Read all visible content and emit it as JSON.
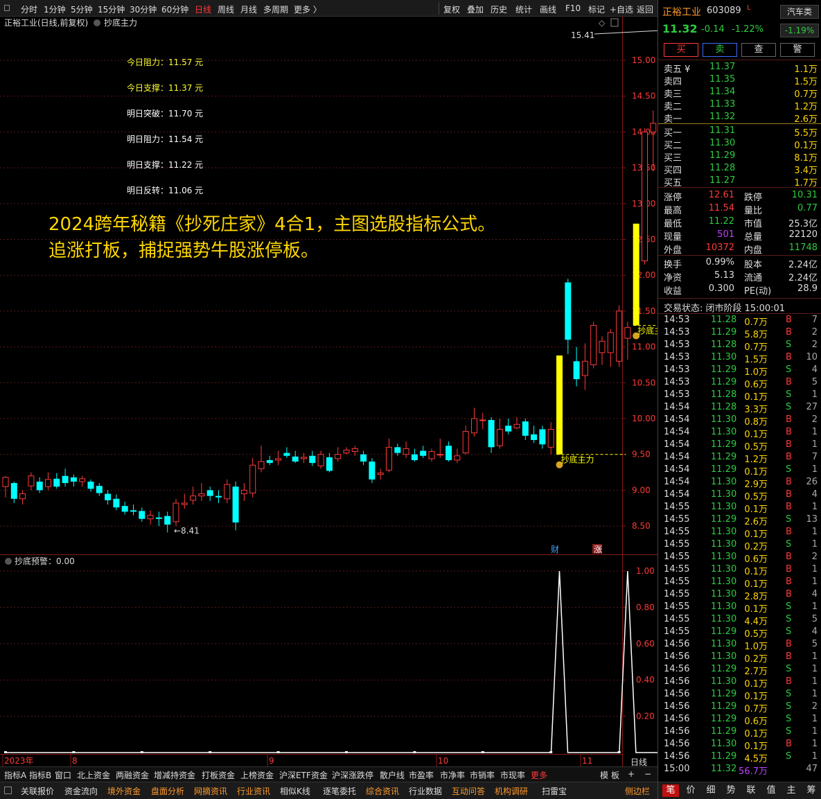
{
  "toolbar": {
    "timeframes": [
      "分时",
      "1分钟",
      "5分钟",
      "15分钟",
      "30分钟",
      "60分钟",
      "日线",
      "周线",
      "月线",
      "多周期",
      "更多 〉"
    ],
    "active_index": 6,
    "right_buttons": [
      "复权",
      "叠加",
      "历史",
      "统计",
      "画线",
      "F10",
      "标记",
      "+自选",
      "返回"
    ]
  },
  "chart": {
    "header_title": "正裕工业(日线,前复权)",
    "indicator_name": "抄底主力",
    "levels": [
      {
        "label": "今日阻力：11.57 元",
        "color": "#ffff33"
      },
      {
        "label": "今日支撑：11.37 元",
        "color": "#ffff33"
      },
      {
        "label": "明日突破：11.70 元",
        "color": "#ffffff"
      },
      {
        "label": "明日阻力：11.54 元",
        "color": "#ffffff"
      },
      {
        "label": "明日支撑：11.22 元",
        "color": "#ffffff"
      },
      {
        "label": "明日反转：11.06 元",
        "color": "#ffffff"
      }
    ],
    "promo_line1": "2024跨年秘籍《抄死庄家》4合1，主图选股指标公式。",
    "promo_line2": "追涨打板，捕捉强势牛股涨停板。",
    "high_label": "15.41",
    "low_label": "←8.41",
    "signal_label": "抄底主力",
    "marker_cai": "财",
    "marker_zhang": "涨",
    "price_axis": [
      "15.00",
      "14.50",
      "14.00",
      "13.50",
      "13.00",
      "12.50",
      "12.00",
      "11.50",
      "11.00",
      "10.50",
      "10.00",
      "9.50",
      "9.00",
      "8.50"
    ],
    "date_labels": [
      "2023年",
      "8",
      "9",
      "10",
      "11"
    ],
    "sub_indicator": "抄底预警：0.00",
    "sub_axis": [
      "1.00",
      "0.80",
      "0.60",
      "0.40",
      "0.20"
    ],
    "period_label": "日线"
  },
  "chart_data": {
    "type": "candlestick",
    "price_range": [
      8.41,
      15.41
    ],
    "candles": [
      {
        "o": 9.05,
        "c": 9.18,
        "h": 9.2,
        "l": 8.9
      },
      {
        "o": 9.1,
        "c": 8.88,
        "h": 9.12,
        "l": 8.82
      },
      {
        "o": 8.88,
        "c": 8.95,
        "h": 9.0,
        "l": 8.8
      },
      {
        "o": 9.06,
        "c": 9.2,
        "h": 9.25,
        "l": 9.0
      },
      {
        "o": 9.12,
        "c": 9.0,
        "h": 9.18,
        "l": 8.96
      },
      {
        "o": 9.05,
        "c": 9.15,
        "h": 9.25,
        "l": 9.0
      },
      {
        "o": 9.16,
        "c": 9.05,
        "h": 9.24,
        "l": 9.02
      },
      {
        "o": 9.2,
        "c": 9.1,
        "h": 9.3,
        "l": 9.05
      },
      {
        "o": 9.18,
        "c": 9.12,
        "h": 9.22,
        "l": 9.05
      },
      {
        "o": 9.12,
        "c": 9.16,
        "h": 9.2,
        "l": 9.05
      },
      {
        "o": 9.12,
        "c": 9.02,
        "h": 9.15,
        "l": 8.98
      },
      {
        "o": 9.06,
        "c": 8.96,
        "h": 9.1,
        "l": 8.92
      },
      {
        "o": 8.95,
        "c": 8.86,
        "h": 9.0,
        "l": 8.8
      },
      {
        "o": 8.88,
        "c": 8.76,
        "h": 8.94,
        "l": 8.72
      },
      {
        "o": 8.78,
        "c": 8.7,
        "h": 8.84,
        "l": 8.66
      },
      {
        "o": 8.72,
        "c": 8.7,
        "h": 8.8,
        "l": 8.65
      },
      {
        "o": 8.71,
        "c": 8.6,
        "h": 8.76,
        "l": 8.56
      },
      {
        "o": 8.6,
        "c": 8.65,
        "h": 8.72,
        "l": 8.52
      },
      {
        "o": 8.62,
        "c": 8.6,
        "h": 8.7,
        "l": 8.5
      },
      {
        "o": 8.64,
        "c": 8.52,
        "h": 8.7,
        "l": 8.41
      },
      {
        "o": 8.56,
        "c": 8.82,
        "h": 8.88,
        "l": 8.5
      },
      {
        "o": 8.8,
        "c": 8.82,
        "h": 8.95,
        "l": 8.74
      },
      {
        "o": 8.86,
        "c": 8.92,
        "h": 9.05,
        "l": 8.8
      },
      {
        "o": 8.92,
        "c": 8.95,
        "h": 9.1,
        "l": 8.85
      },
      {
        "o": 9.0,
        "c": 8.92,
        "h": 9.05,
        "l": 8.85
      },
      {
        "o": 8.92,
        "c": 8.9,
        "h": 9.0,
        "l": 8.82
      },
      {
        "o": 8.88,
        "c": 9.08,
        "h": 9.15,
        "l": 8.82
      },
      {
        "o": 9.05,
        "c": 8.55,
        "h": 9.12,
        "l": 8.44
      },
      {
        "o": 8.95,
        "c": 9.0,
        "h": 9.1,
        "l": 8.85
      },
      {
        "o": 8.96,
        "c": 9.35,
        "h": 9.45,
        "l": 8.9
      },
      {
        "o": 9.3,
        "c": 9.4,
        "h": 9.62,
        "l": 9.25
      },
      {
        "o": 9.42,
        "c": 9.38,
        "h": 9.48,
        "l": 9.35
      },
      {
        "o": 9.42,
        "c": 9.44,
        "h": 9.55,
        "l": 9.35
      },
      {
        "o": 9.52,
        "c": 9.48,
        "h": 9.6,
        "l": 9.45
      },
      {
        "o": 9.47,
        "c": 9.4,
        "h": 9.55,
        "l": 9.38
      },
      {
        "o": 9.44,
        "c": 9.46,
        "h": 9.52,
        "l": 9.38
      },
      {
        "o": 9.48,
        "c": 9.38,
        "h": 9.55,
        "l": 9.34
      },
      {
        "o": 9.34,
        "c": 9.5,
        "h": 9.55,
        "l": 9.3
      },
      {
        "o": 9.46,
        "c": 9.27,
        "h": 9.52,
        "l": 9.25
      },
      {
        "o": 9.44,
        "c": 9.5,
        "h": 9.6,
        "l": 9.4
      },
      {
        "o": 9.52,
        "c": 9.56,
        "h": 9.6,
        "l": 9.5
      },
      {
        "o": 9.54,
        "c": 9.58,
        "h": 9.62,
        "l": 9.48
      },
      {
        "o": 9.5,
        "c": 9.4,
        "h": 9.55,
        "l": 9.35
      },
      {
        "o": 9.4,
        "c": 9.15,
        "h": 9.45,
        "l": 9.1
      },
      {
        "o": 9.22,
        "c": 9.24,
        "h": 9.3,
        "l": 9.15
      },
      {
        "o": 9.28,
        "c": 9.6,
        "h": 9.72,
        "l": 9.25
      },
      {
        "o": 9.6,
        "c": 9.52,
        "h": 9.65,
        "l": 9.48
      },
      {
        "o": 9.5,
        "c": 9.58,
        "h": 9.68,
        "l": 9.45
      },
      {
        "o": 9.5,
        "c": 9.42,
        "h": 9.58,
        "l": 9.4
      },
      {
        "o": 9.55,
        "c": 9.48,
        "h": 9.62,
        "l": 9.45
      },
      {
        "o": 9.44,
        "c": 9.54,
        "h": 9.58,
        "l": 9.4
      },
      {
        "o": 9.5,
        "c": 9.5,
        "h": 9.72,
        "l": 9.45
      },
      {
        "o": 9.62,
        "c": 9.42,
        "h": 9.68,
        "l": 9.4
      },
      {
        "o": 9.42,
        "c": 9.48,
        "h": 9.58,
        "l": 9.38
      },
      {
        "o": 9.52,
        "c": 9.82,
        "h": 9.9,
        "l": 9.5
      },
      {
        "o": 9.8,
        "c": 10.0,
        "h": 10.15,
        "l": 9.75
      },
      {
        "o": 9.98,
        "c": 9.98,
        "h": 10.08,
        "l": 9.85
      },
      {
        "o": 9.98,
        "c": 9.6,
        "h": 10.02,
        "l": 9.52
      },
      {
        "o": 9.62,
        "c": 9.85,
        "h": 10.0,
        "l": 9.58
      },
      {
        "o": 9.9,
        "c": 9.82,
        "h": 10.0,
        "l": 9.78
      },
      {
        "o": 9.87,
        "c": 9.92,
        "h": 10.02,
        "l": 9.85
      },
      {
        "o": 9.96,
        "c": 9.76,
        "h": 10.0,
        "l": 9.7
      },
      {
        "o": 9.78,
        "c": 9.7,
        "h": 9.9,
        "l": 9.66
      },
      {
        "o": 9.85,
        "c": 9.64,
        "h": 9.9,
        "l": 9.58
      },
      {
        "o": 9.6,
        "c": 9.85,
        "h": 9.95,
        "l": 9.5
      },
      {
        "o": 9.5,
        "c": 10.88,
        "h": 10.88,
        "l": 9.5,
        "yellow": true
      },
      {
        "o": 11.9,
        "c": 11.1,
        "h": 11.95,
        "l": 10.9
      },
      {
        "o": 10.8,
        "c": 10.55,
        "h": 11.0,
        "l": 10.45
      },
      {
        "o": 10.6,
        "c": 10.8,
        "h": 11.05,
        "l": 10.4
      },
      {
        "o": 10.75,
        "c": 11.3,
        "h": 11.35,
        "l": 10.7
      },
      {
        "o": 10.92,
        "c": 11.08,
        "h": 11.15,
        "l": 10.75
      },
      {
        "o": 10.92,
        "c": 11.2,
        "h": 11.25,
        "l": 10.72
      },
      {
        "o": 10.8,
        "c": 11.5,
        "h": 11.58,
        "l": 10.72
      },
      {
        "o": 11.12,
        "c": 11.27,
        "h": 11.35,
        "l": 10.82
      },
      {
        "o": 11.3,
        "c": 12.72,
        "h": 12.72,
        "l": 11.3,
        "yellow": true
      },
      {
        "o": 12.2,
        "c": 14.0,
        "h": 14.05,
        "l": 12.15
      },
      {
        "o": 14.0,
        "c": 14.12,
        "h": 14.3,
        "l": 13.45
      },
      {
        "o": 14.75,
        "c": 13.85,
        "h": 15.41,
        "l": 13.3
      }
    ],
    "alert_peaks": [
      65,
      73
    ]
  },
  "quote": {
    "name": "正裕工业",
    "code": "603089",
    "tag": "L",
    "sector": "汽车类",
    "sector_change": "-1.19%",
    "price": "11.32",
    "change": "-0.14",
    "change_pct": "-1.22%",
    "actions": [
      "买",
      "卖",
      "查",
      "警"
    ],
    "asks": [
      {
        "label": "卖五 ¥",
        "price": "11.37",
        "vol": "1.1万"
      },
      {
        "label": "卖四",
        "price": "11.35",
        "vol": "1.5万"
      },
      {
        "label": "卖三",
        "price": "11.34",
        "vol": "0.7万"
      },
      {
        "label": "卖二",
        "price": "11.33",
        "vol": "1.2万"
      },
      {
        "label": "卖一",
        "price": "11.32",
        "vol": "2.6万"
      }
    ],
    "bids": [
      {
        "label": "买一",
        "price": "11.31",
        "vol": "5.5万"
      },
      {
        "label": "买二",
        "price": "11.30",
        "vol": "0.1万"
      },
      {
        "label": "买三",
        "price": "11.29",
        "vol": "8.1万"
      },
      {
        "label": "买四",
        "price": "11.28",
        "vol": "3.4万"
      },
      {
        "label": "买五",
        "price": "11.27",
        "vol": "1.7万"
      }
    ],
    "stats": [
      {
        "l1": "涨停",
        "v1": "12.61",
        "c1": "#ff3a3a",
        "l2": "跌停",
        "v2": "10.31",
        "c2": "#2ecc40"
      },
      {
        "l1": "最高",
        "v1": "11.54",
        "c1": "#ff3a3a",
        "l2": "量比",
        "v2": "0.77",
        "c2": "#2ecc40"
      },
      {
        "l1": "最低",
        "v1": "11.22",
        "c1": "#2ecc40",
        "l2": "市值",
        "v2": "25.3亿",
        "c2": "#dddddd"
      },
      {
        "l1": "现量",
        "v1": "501",
        "c1": "#c040ff",
        "l2": "总量",
        "v2": "22120",
        "c2": "#dddddd"
      },
      {
        "l1": "外盘",
        "v1": "10372",
        "c1": "#ff3a3a",
        "l2": "内盘",
        "v2": "11748",
        "c2": "#2ecc40"
      }
    ],
    "stats2": [
      {
        "l1": "换手",
        "v1": "0.99%",
        "l2": "股本",
        "v2": "2.24亿"
      },
      {
        "l1": "净资",
        "v1": "5.13",
        "l2": "流通",
        "v2": "2.24亿"
      },
      {
        "l1": "收益",
        "v1": "0.300",
        "l2": "PE(动)",
        "v2": "28.9"
      }
    ],
    "trade_status": "交易状态: 闭市阶段 15:00:01",
    "ticks": [
      [
        "14:53",
        "11.28",
        "0.7万",
        "B",
        "7"
      ],
      [
        "14:53",
        "11.29",
        "5.8万",
        "B",
        "2"
      ],
      [
        "14:53",
        "11.28",
        "0.7万",
        "S",
        "2"
      ],
      [
        "14:53",
        "11.30",
        "1.5万",
        "B",
        "10"
      ],
      [
        "14:53",
        "11.29",
        "1.0万",
        "S",
        "4"
      ],
      [
        "14:53",
        "11.29",
        "0.6万",
        "B",
        "5"
      ],
      [
        "14:53",
        "11.28",
        "0.1万",
        "S",
        "1"
      ],
      [
        "14:54",
        "11.28",
        "3.3万",
        "S",
        "27"
      ],
      [
        "14:54",
        "11.30",
        "0.8万",
        "B",
        "2"
      ],
      [
        "14:54",
        "11.30",
        "0.1万",
        "B",
        "1"
      ],
      [
        "14:54",
        "11.29",
        "0.5万",
        "B",
        "1"
      ],
      [
        "14:54",
        "11.29",
        "1.2万",
        "B",
        "7"
      ],
      [
        "14:54",
        "11.29",
        "0.1万",
        "S",
        "1"
      ],
      [
        "14:54",
        "11.30",
        "2.9万",
        "B",
        "26"
      ],
      [
        "14:54",
        "11.30",
        "0.5万",
        "B",
        "4"
      ],
      [
        "14:55",
        "11.30",
        "0.1万",
        "B",
        "1"
      ],
      [
        "14:55",
        "11.29",
        "2.6万",
        "S",
        "13"
      ],
      [
        "14:55",
        "11.30",
        "0.1万",
        "B",
        "1"
      ],
      [
        "14:55",
        "11.30",
        "0.2万",
        "S",
        "1"
      ],
      [
        "14:55",
        "11.30",
        "0.6万",
        "B",
        "2"
      ],
      [
        "14:55",
        "11.30",
        "0.1万",
        "B",
        "1"
      ],
      [
        "14:55",
        "11.30",
        "0.1万",
        "B",
        "1"
      ],
      [
        "14:55",
        "11.30",
        "2.8万",
        "B",
        "4"
      ],
      [
        "14:55",
        "11.30",
        "0.1万",
        "S",
        "1"
      ],
      [
        "14:55",
        "11.30",
        "4.4万",
        "S",
        "5"
      ],
      [
        "14:55",
        "11.29",
        "0.5万",
        "S",
        "4"
      ],
      [
        "14:56",
        "11.30",
        "1.0万",
        "B",
        "5"
      ],
      [
        "14:56",
        "11.30",
        "0.2万",
        "B",
        "1"
      ],
      [
        "14:56",
        "11.29",
        "2.7万",
        "S",
        "1"
      ],
      [
        "14:56",
        "11.30",
        "0.1万",
        "B",
        "1"
      ],
      [
        "14:56",
        "11.29",
        "0.1万",
        "S",
        "1"
      ],
      [
        "14:56",
        "11.29",
        "0.7万",
        "S",
        "2"
      ],
      [
        "14:56",
        "11.29",
        "0.6万",
        "S",
        "1"
      ],
      [
        "14:56",
        "11.29",
        "0.1万",
        "S",
        "1"
      ],
      [
        "14:56",
        "11.30",
        "0.1万",
        "B",
        "1"
      ],
      [
        "14:56",
        "11.29",
        "4.5万",
        "S",
        "1"
      ],
      [
        "15:00",
        "11.32",
        "56.7万",
        "",
        "47"
      ]
    ],
    "bottom_tabs": [
      "笔",
      "价",
      "细",
      "势",
      "联",
      "值",
      "主",
      "筹"
    ]
  },
  "bottom_bar1": [
    "指标A",
    "指标B",
    "窗口",
    "北上资金",
    "两融资金",
    "增减持资金",
    "打板资金",
    "上榜资金",
    "沪深ETF资金",
    "沪深涨跌停",
    "散户线",
    "市盈率",
    "市净率",
    "市销率",
    "市现率",
    "更多"
  ],
  "bottom_bar1_right": [
    "模",
    "板",
    "+",
    "−"
  ],
  "bottom_bar2": [
    "关联报价",
    "资金流向",
    "境外资金",
    "盘面分析",
    "网摘资讯",
    "行业资讯",
    "相似K线",
    "逐笔委托",
    "综合资讯",
    "行业数据",
    "互动问答",
    "机构调研",
    "扫雷宝"
  ],
  "bottom_bar2_right": "侧边栏",
  "colors": {
    "up": "#ff3a3a",
    "down": "#2ecc40",
    "cyan": "#00ffff",
    "yellow": "#ffff00",
    "grid": "#5a1a1a"
  }
}
